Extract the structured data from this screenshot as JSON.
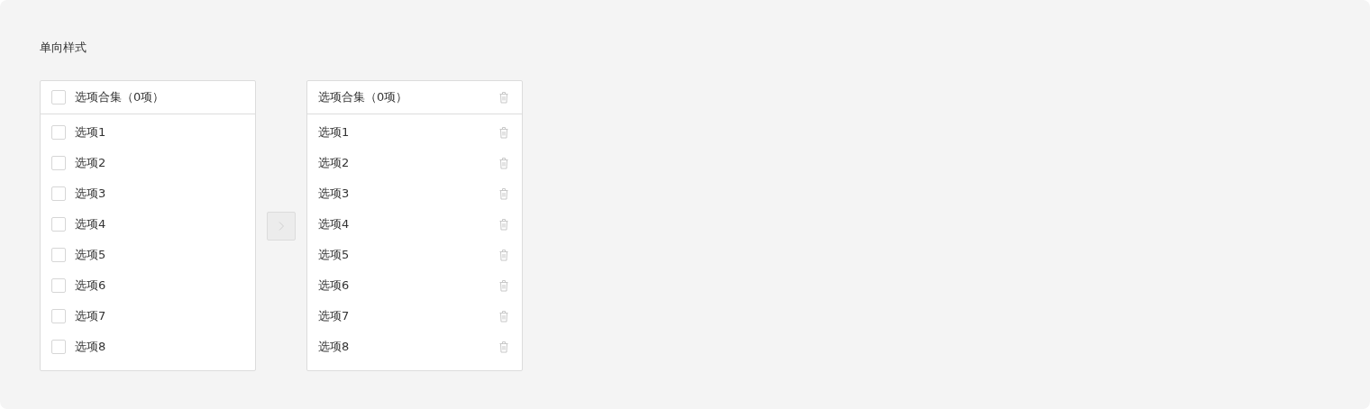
{
  "title": "单向样式",
  "source": {
    "header": {
      "label": "选项合集（0项）",
      "checked": false
    },
    "items": [
      {
        "label": "选项1",
        "checked": false
      },
      {
        "label": "选项2",
        "checked": false
      },
      {
        "label": "选项3",
        "checked": false
      },
      {
        "label": "选项4",
        "checked": false
      },
      {
        "label": "选项5",
        "checked": false
      },
      {
        "label": "选项6",
        "checked": false
      },
      {
        "label": "选项7",
        "checked": false
      },
      {
        "label": "选项8",
        "checked": false
      }
    ]
  },
  "transfer_button": {
    "disabled": true
  },
  "target": {
    "header": {
      "label": "选项合集（0项）"
    },
    "items": [
      {
        "label": "选项1"
      },
      {
        "label": "选项2"
      },
      {
        "label": "选项3"
      },
      {
        "label": "选项4"
      },
      {
        "label": "选项5"
      },
      {
        "label": "选项6"
      },
      {
        "label": "选项7"
      },
      {
        "label": "选项8"
      }
    ]
  }
}
